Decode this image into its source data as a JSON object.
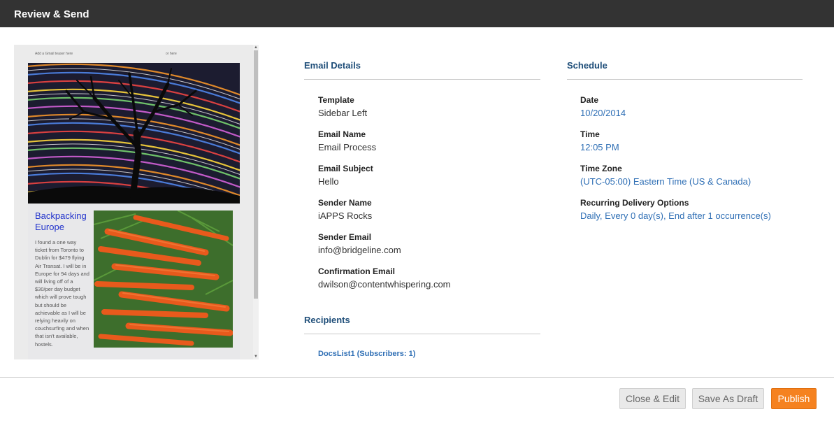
{
  "header": {
    "title": "Review & Send"
  },
  "preview": {
    "teaser_left": "Add a Gmail teaser here",
    "teaser_right": "or here",
    "article_title": "Backpacking Europe",
    "article_body": "I found a one way ticket from Toronto to Dublin for $479 flying Air Transat.  I will be in Europe for 94 days and will living off of a $30/per day budget which will prove tough but should be achievable as I will be relying heavily on couchsurfing and when that isn't available, hostels."
  },
  "email_details": {
    "heading": "Email Details",
    "fields": [
      {
        "label": "Template",
        "value": "Sidebar Left"
      },
      {
        "label": "Email Name",
        "value": "Email Process"
      },
      {
        "label": "Email Subject",
        "value": "Hello"
      },
      {
        "label": "Sender Name",
        "value": "iAPPS Rocks"
      },
      {
        "label": "Sender Email",
        "value": "info@bridgeline.com"
      },
      {
        "label": "Confirmation Email",
        "value": "dwilson@contentwhispering.com"
      }
    ]
  },
  "recipients": {
    "heading": "Recipients",
    "items": [
      "DocsList1 (Subscribers: 1)"
    ]
  },
  "schedule": {
    "heading": "Schedule",
    "fields": [
      {
        "label": "Date",
        "value": "10/20/2014"
      },
      {
        "label": "Time",
        "value": "12:05 PM"
      },
      {
        "label": "Time Zone",
        "value": "(UTC-05:00) Eastern Time (US & Canada)"
      },
      {
        "label": "Recurring Delivery Options",
        "value": "Daily, Every 0 day(s), End after 1 occurrence(s)"
      }
    ]
  },
  "footer": {
    "close_edit": "Close & Edit",
    "save_draft": "Save As Draft",
    "publish": "Publish"
  },
  "colors": {
    "header_bg": "#333333",
    "heading_blue": "#1f4e79",
    "link_blue": "#2f6fb5",
    "publish_orange": "#f58220"
  }
}
